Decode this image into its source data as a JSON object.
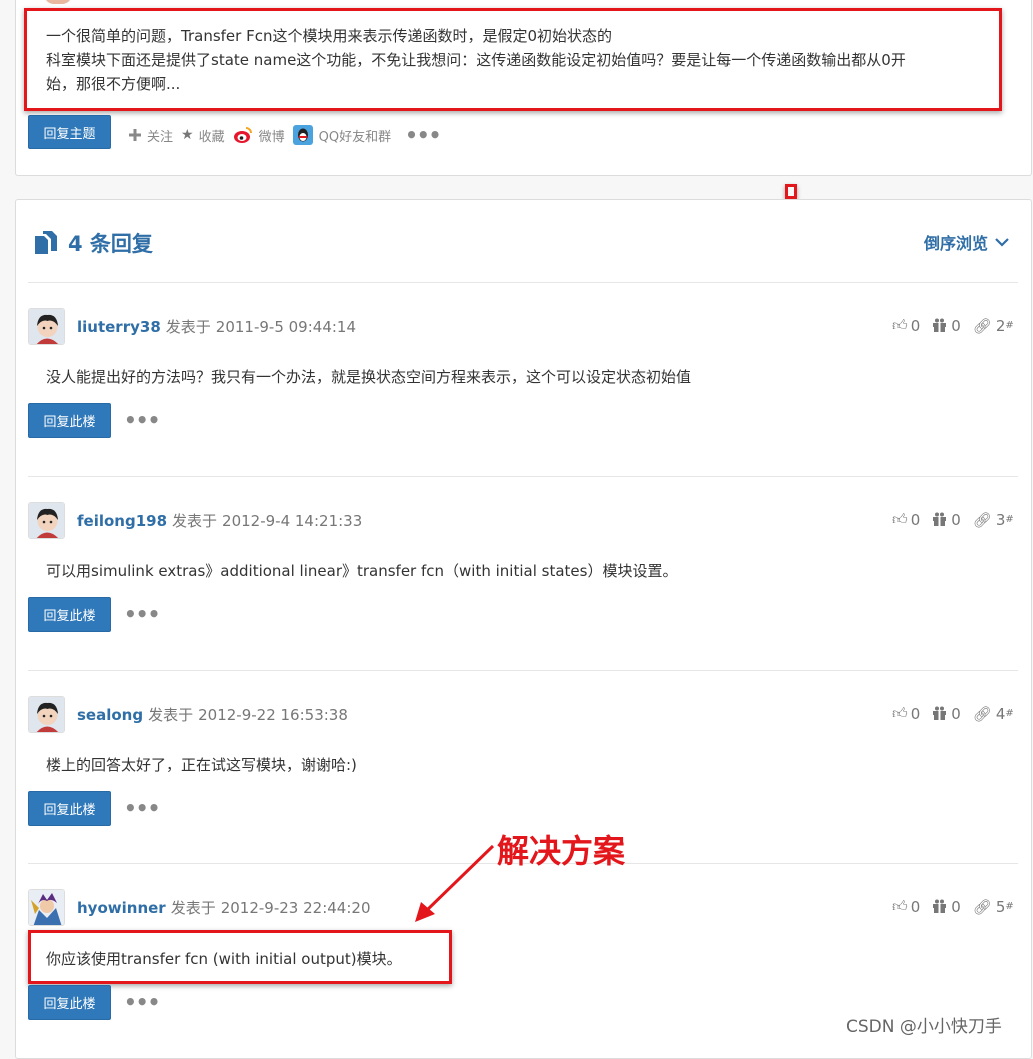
{
  "question": {
    "lines": [
      "一个很简单的问题，Transfer Fcn这个模块用来表示传递函数时，是假定0初始状态的",
      "科室模块下面还是提供了state name这个功能，不免让我想问：这传递函数能设定初始值吗？要是让每一个传递函数输出都从0开",
      "始，那很不方便啊..."
    ],
    "reply_button": "回复主题",
    "actions": {
      "follow": "关注",
      "favorite": "收藏",
      "weibo": "微博",
      "qq": "QQ好友和群"
    }
  },
  "replies_header": {
    "count_label": "4 条回复",
    "sort_label": "倒序浏览"
  },
  "replies": [
    {
      "user": "liuterry38",
      "posted_label": "发表于",
      "time": "2011-9-5 09:44:14",
      "likes": "0",
      "dislikes": "0",
      "floor": "2",
      "text": "没人能提出好的方法吗？我只有一个办法，就是换状态空间方程来表示，这个可以设定状态初始值",
      "button": "回复此楼"
    },
    {
      "user": "feilong198",
      "posted_label": "发表于",
      "time": "2012-9-4 14:21:33",
      "likes": "0",
      "dislikes": "0",
      "floor": "3",
      "text": "可以用simulink extras》additional linear》transfer fcn（with initial states）模块设置。",
      "button": "回复此楼"
    },
    {
      "user": "sealong",
      "posted_label": "发表于",
      "time": "2012-9-22 16:53:38",
      "likes": "0",
      "dislikes": "0",
      "floor": "4",
      "text": "楼上的回答太好了，正在试这写模块，谢谢哈:)",
      "button": "回复此楼"
    },
    {
      "user": "hyowinner",
      "posted_label": "发表于",
      "time": "2012-9-23 22:44:20",
      "likes": "0",
      "dislikes": "0",
      "floor": "5",
      "text": "你应该使用transfer fcn (with initial output)模块。",
      "button": "回复此楼"
    }
  ],
  "annotation": "解决方案",
  "watermark": "CSDN @小小快刀手",
  "colors": {
    "link": "#2f6ea6",
    "button": "#2f78b9",
    "highlight": "#e3161b"
  }
}
